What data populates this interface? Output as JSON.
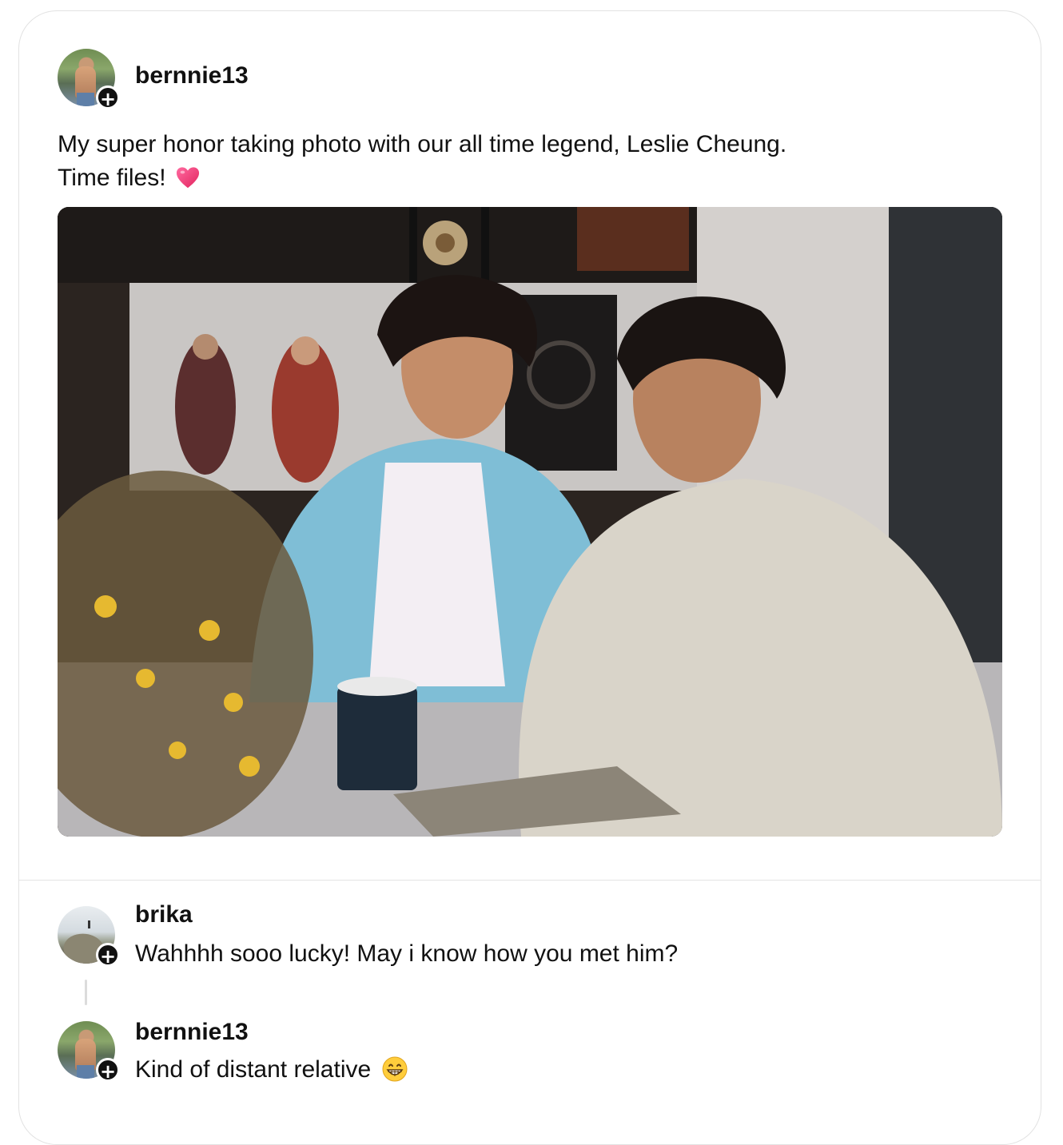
{
  "post": {
    "username": "bernnie13",
    "text_line1": "My super honor taking photo with our all time legend, Leslie Cheung.",
    "text_line2": "Time files!",
    "text_emoji": "heart-icon",
    "photo_alt": "photo-image"
  },
  "comments": [
    {
      "username": "brika",
      "text": "Wahhhh sooo lucky! May i know how you met him?"
    },
    {
      "username": "bernnie13",
      "text": "Kind of distant relative",
      "emoji": "grinning-face-icon"
    }
  ],
  "colors": {
    "accent": "#111111",
    "heart": "#ec3e78",
    "divider": "#e4e4e4"
  }
}
